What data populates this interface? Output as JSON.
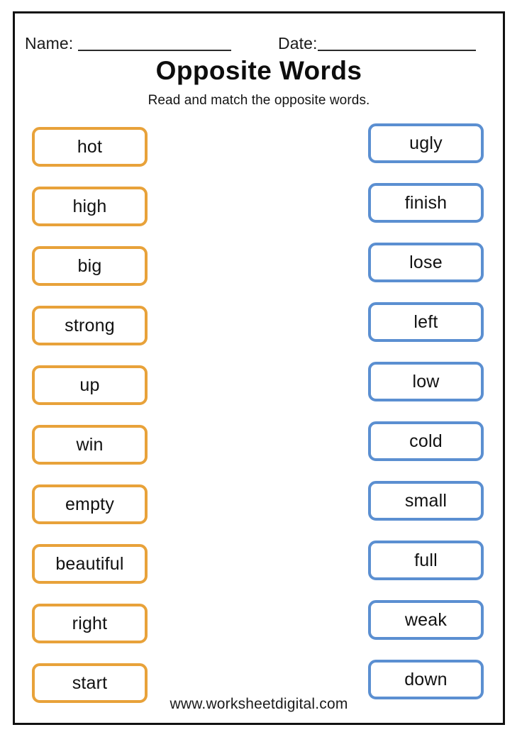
{
  "worksheet": {
    "title": "Opposite Words",
    "subtitle": "Read and match the opposite words.",
    "footer": "www.worksheetdigital.com",
    "header": {
      "name_label": "Name:",
      "name_value": "",
      "date_label": "Date:",
      "date_value": ""
    },
    "colors": {
      "left_border": "#e8a23a",
      "right_border": "#5b8fd1",
      "page_border": "#111111",
      "text": "#111111"
    },
    "left_column": [
      {
        "label": "hot"
      },
      {
        "label": "high"
      },
      {
        "label": "big"
      },
      {
        "label": "strong"
      },
      {
        "label": "up"
      },
      {
        "label": "win"
      },
      {
        "label": "empty"
      },
      {
        "label": "beautiful"
      },
      {
        "label": "right"
      },
      {
        "label": "start"
      }
    ],
    "right_column": [
      {
        "label": "ugly"
      },
      {
        "label": "finish"
      },
      {
        "label": "lose"
      },
      {
        "label": "left"
      },
      {
        "label": "low"
      },
      {
        "label": "cold"
      },
      {
        "label": "small"
      },
      {
        "label": "full"
      },
      {
        "label": "weak"
      },
      {
        "label": "down"
      }
    ]
  }
}
